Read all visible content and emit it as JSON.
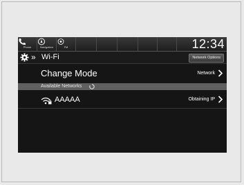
{
  "topbar": {
    "buttons": [
      {
        "label": "Phone",
        "icon": "phone-icon"
      },
      {
        "label": "Navigation",
        "icon": "navigation-icon"
      },
      {
        "label": "FM",
        "icon": "radio-icon"
      }
    ],
    "clock": "12:34"
  },
  "header": {
    "arrows": "»",
    "title": "Wi-Fi",
    "options_label": "Network Options"
  },
  "change_mode": {
    "label": "Change Mode",
    "value": "Network"
  },
  "available": {
    "label": "Available Networks"
  },
  "networks": [
    {
      "name": "AAAAA",
      "status": "Obtaining IP"
    }
  ]
}
